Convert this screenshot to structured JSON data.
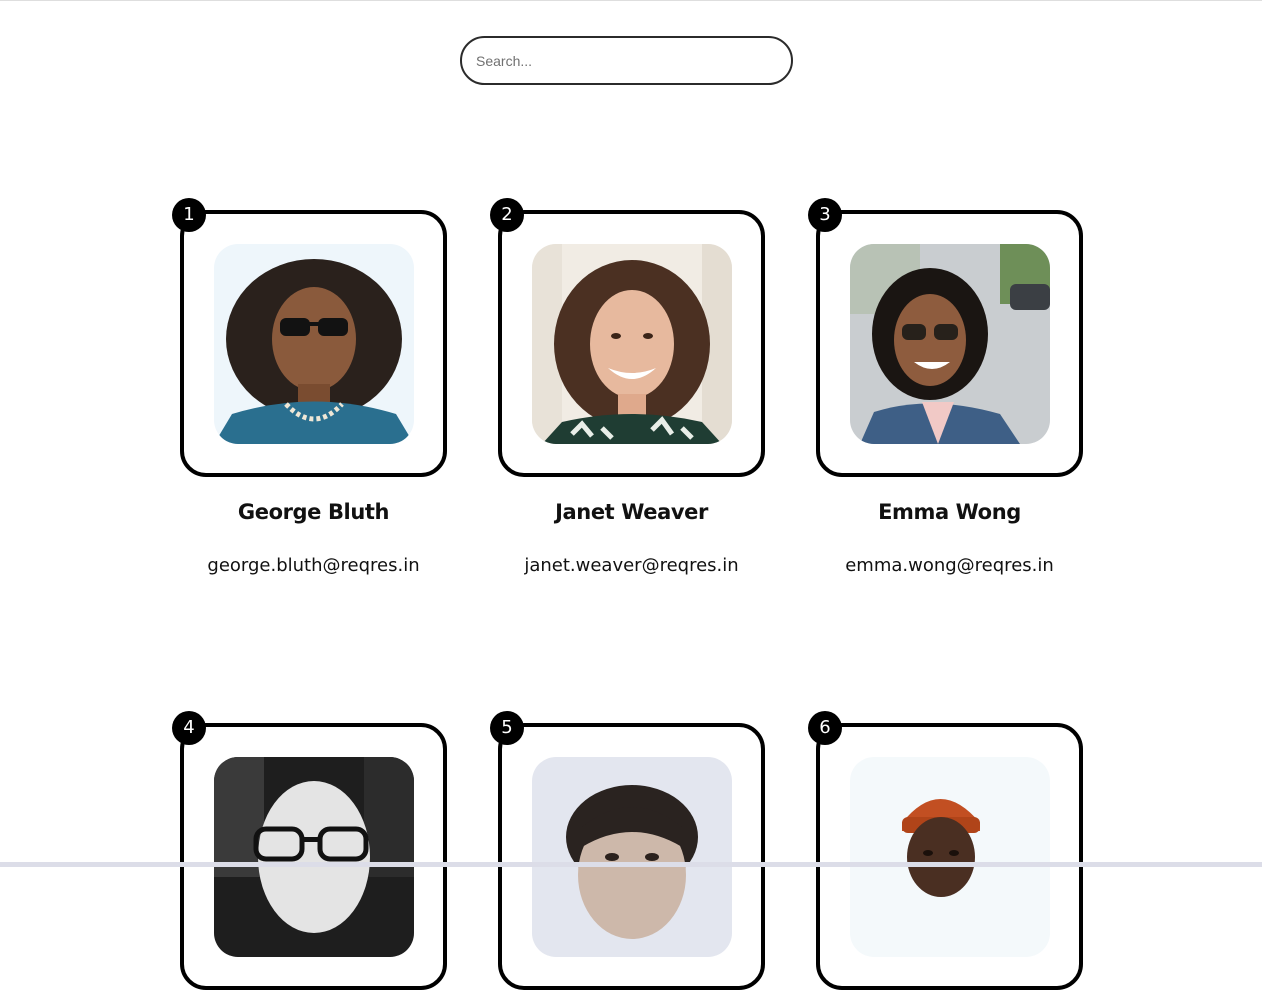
{
  "search": {
    "placeholder": "Search..."
  },
  "users": [
    {
      "id": "1",
      "name": "George Bluth",
      "email": "george.bluth@reqres.in"
    },
    {
      "id": "2",
      "name": "Janet Weaver",
      "email": "janet.weaver@reqres.in"
    },
    {
      "id": "3",
      "name": "Emma Wong",
      "email": "emma.wong@reqres.in"
    },
    {
      "id": "4",
      "name": "",
      "email": ""
    },
    {
      "id": "5",
      "name": "",
      "email": ""
    },
    {
      "id": "6",
      "name": "",
      "email": ""
    }
  ],
  "colors": {
    "card_border": "#000000",
    "badge_background": "#000000",
    "badge_text": "#ffffff",
    "search_border": "#2b2b2b"
  }
}
